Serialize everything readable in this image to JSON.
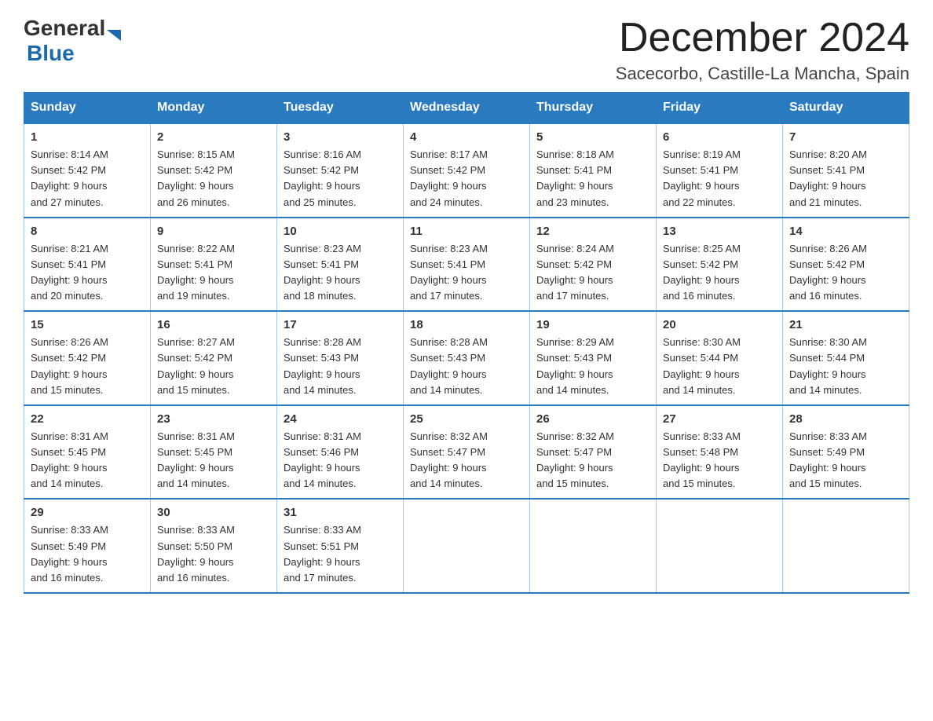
{
  "header": {
    "logo_general": "General",
    "logo_blue": "Blue",
    "title": "December 2024",
    "subtitle": "Sacecorbo, Castille-La Mancha, Spain"
  },
  "days_of_week": [
    "Sunday",
    "Monday",
    "Tuesday",
    "Wednesday",
    "Thursday",
    "Friday",
    "Saturday"
  ],
  "weeks": [
    [
      {
        "day": "1",
        "sunrise": "8:14 AM",
        "sunset": "5:42 PM",
        "daylight": "9 hours and 27 minutes."
      },
      {
        "day": "2",
        "sunrise": "8:15 AM",
        "sunset": "5:42 PM",
        "daylight": "9 hours and 26 minutes."
      },
      {
        "day": "3",
        "sunrise": "8:16 AM",
        "sunset": "5:42 PM",
        "daylight": "9 hours and 25 minutes."
      },
      {
        "day": "4",
        "sunrise": "8:17 AM",
        "sunset": "5:42 PM",
        "daylight": "9 hours and 24 minutes."
      },
      {
        "day": "5",
        "sunrise": "8:18 AM",
        "sunset": "5:41 PM",
        "daylight": "9 hours and 23 minutes."
      },
      {
        "day": "6",
        "sunrise": "8:19 AM",
        "sunset": "5:41 PM",
        "daylight": "9 hours and 22 minutes."
      },
      {
        "day": "7",
        "sunrise": "8:20 AM",
        "sunset": "5:41 PM",
        "daylight": "9 hours and 21 minutes."
      }
    ],
    [
      {
        "day": "8",
        "sunrise": "8:21 AM",
        "sunset": "5:41 PM",
        "daylight": "9 hours and 20 minutes."
      },
      {
        "day": "9",
        "sunrise": "8:22 AM",
        "sunset": "5:41 PM",
        "daylight": "9 hours and 19 minutes."
      },
      {
        "day": "10",
        "sunrise": "8:23 AM",
        "sunset": "5:41 PM",
        "daylight": "9 hours and 18 minutes."
      },
      {
        "day": "11",
        "sunrise": "8:23 AM",
        "sunset": "5:41 PM",
        "daylight": "9 hours and 17 minutes."
      },
      {
        "day": "12",
        "sunrise": "8:24 AM",
        "sunset": "5:42 PM",
        "daylight": "9 hours and 17 minutes."
      },
      {
        "day": "13",
        "sunrise": "8:25 AM",
        "sunset": "5:42 PM",
        "daylight": "9 hours and 16 minutes."
      },
      {
        "day": "14",
        "sunrise": "8:26 AM",
        "sunset": "5:42 PM",
        "daylight": "9 hours and 16 minutes."
      }
    ],
    [
      {
        "day": "15",
        "sunrise": "8:26 AM",
        "sunset": "5:42 PM",
        "daylight": "9 hours and 15 minutes."
      },
      {
        "day": "16",
        "sunrise": "8:27 AM",
        "sunset": "5:42 PM",
        "daylight": "9 hours and 15 minutes."
      },
      {
        "day": "17",
        "sunrise": "8:28 AM",
        "sunset": "5:43 PM",
        "daylight": "9 hours and 14 minutes."
      },
      {
        "day": "18",
        "sunrise": "8:28 AM",
        "sunset": "5:43 PM",
        "daylight": "9 hours and 14 minutes."
      },
      {
        "day": "19",
        "sunrise": "8:29 AM",
        "sunset": "5:43 PM",
        "daylight": "9 hours and 14 minutes."
      },
      {
        "day": "20",
        "sunrise": "8:30 AM",
        "sunset": "5:44 PM",
        "daylight": "9 hours and 14 minutes."
      },
      {
        "day": "21",
        "sunrise": "8:30 AM",
        "sunset": "5:44 PM",
        "daylight": "9 hours and 14 minutes."
      }
    ],
    [
      {
        "day": "22",
        "sunrise": "8:31 AM",
        "sunset": "5:45 PM",
        "daylight": "9 hours and 14 minutes."
      },
      {
        "day": "23",
        "sunrise": "8:31 AM",
        "sunset": "5:45 PM",
        "daylight": "9 hours and 14 minutes."
      },
      {
        "day": "24",
        "sunrise": "8:31 AM",
        "sunset": "5:46 PM",
        "daylight": "9 hours and 14 minutes."
      },
      {
        "day": "25",
        "sunrise": "8:32 AM",
        "sunset": "5:47 PM",
        "daylight": "9 hours and 14 minutes."
      },
      {
        "day": "26",
        "sunrise": "8:32 AM",
        "sunset": "5:47 PM",
        "daylight": "9 hours and 15 minutes."
      },
      {
        "day": "27",
        "sunrise": "8:33 AM",
        "sunset": "5:48 PM",
        "daylight": "9 hours and 15 minutes."
      },
      {
        "day": "28",
        "sunrise": "8:33 AM",
        "sunset": "5:49 PM",
        "daylight": "9 hours and 15 minutes."
      }
    ],
    [
      {
        "day": "29",
        "sunrise": "8:33 AM",
        "sunset": "5:49 PM",
        "daylight": "9 hours and 16 minutes."
      },
      {
        "day": "30",
        "sunrise": "8:33 AM",
        "sunset": "5:50 PM",
        "daylight": "9 hours and 16 minutes."
      },
      {
        "day": "31",
        "sunrise": "8:33 AM",
        "sunset": "5:51 PM",
        "daylight": "9 hours and 17 minutes."
      },
      null,
      null,
      null,
      null
    ]
  ],
  "labels": {
    "sunrise": "Sunrise:",
    "sunset": "Sunset:",
    "daylight": "Daylight:"
  }
}
